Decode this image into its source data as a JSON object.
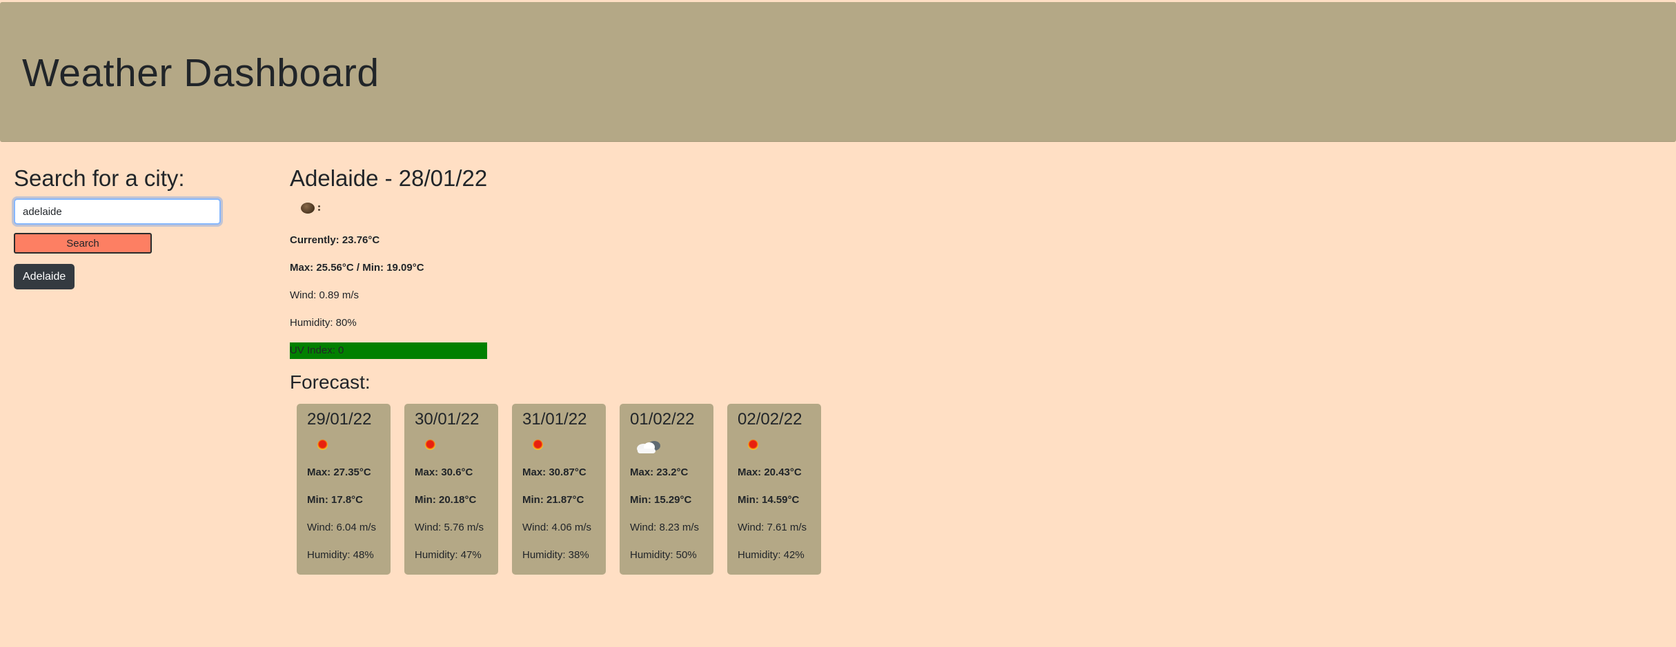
{
  "header": {
    "title": "Weather Dashboard"
  },
  "sidebar": {
    "heading": "Search for a city:",
    "search_value": "adelaide",
    "search_button_label": "Search",
    "history": [
      "Adelaide"
    ]
  },
  "current": {
    "title": "Adelaide - 28/01/22",
    "icon": "night-clear-icon",
    "currently": "Currently: 23.76°C",
    "maxmin": "Max: 25.56°C / Min: 19.09°C",
    "wind": "Wind: 0.89 m/s",
    "humidity": "Humidity: 80%",
    "uv": "UV Index: 0",
    "uv_color": "#008000"
  },
  "forecast": {
    "title": "Forecast:",
    "days": [
      {
        "date": "29/01/22",
        "icon": "sun-icon",
        "max": "Max: 27.35°C",
        "min": "Min: 17.8°C",
        "wind": "Wind: 6.04 m/s",
        "humidity": "Humidity: 48%"
      },
      {
        "date": "30/01/22",
        "icon": "sun-icon",
        "max": "Max: 30.6°C",
        "min": "Min: 20.18°C",
        "wind": "Wind: 5.76 m/s",
        "humidity": "Humidity: 47%"
      },
      {
        "date": "31/01/22",
        "icon": "sun-icon",
        "max": "Max: 30.87°C",
        "min": "Min: 21.87°C",
        "wind": "Wind: 4.06 m/s",
        "humidity": "Humidity: 38%"
      },
      {
        "date": "01/02/22",
        "icon": "cloud-icon",
        "max": "Max: 23.2°C",
        "min": "Min: 15.29°C",
        "wind": "Wind: 8.23 m/s",
        "humidity": "Humidity: 50%"
      },
      {
        "date": "02/02/22",
        "icon": "sun-icon",
        "max": "Max: 20.43°C",
        "min": "Min: 14.59°C",
        "wind": "Wind: 7.61 m/s",
        "humidity": "Humidity: 42%"
      }
    ]
  },
  "colors": {
    "page_bg": "#ffdfc4",
    "header_bg": "#b4a886",
    "search_button": "#fd7f63",
    "history_button": "#343a40",
    "card_bg": "#b4a886"
  }
}
